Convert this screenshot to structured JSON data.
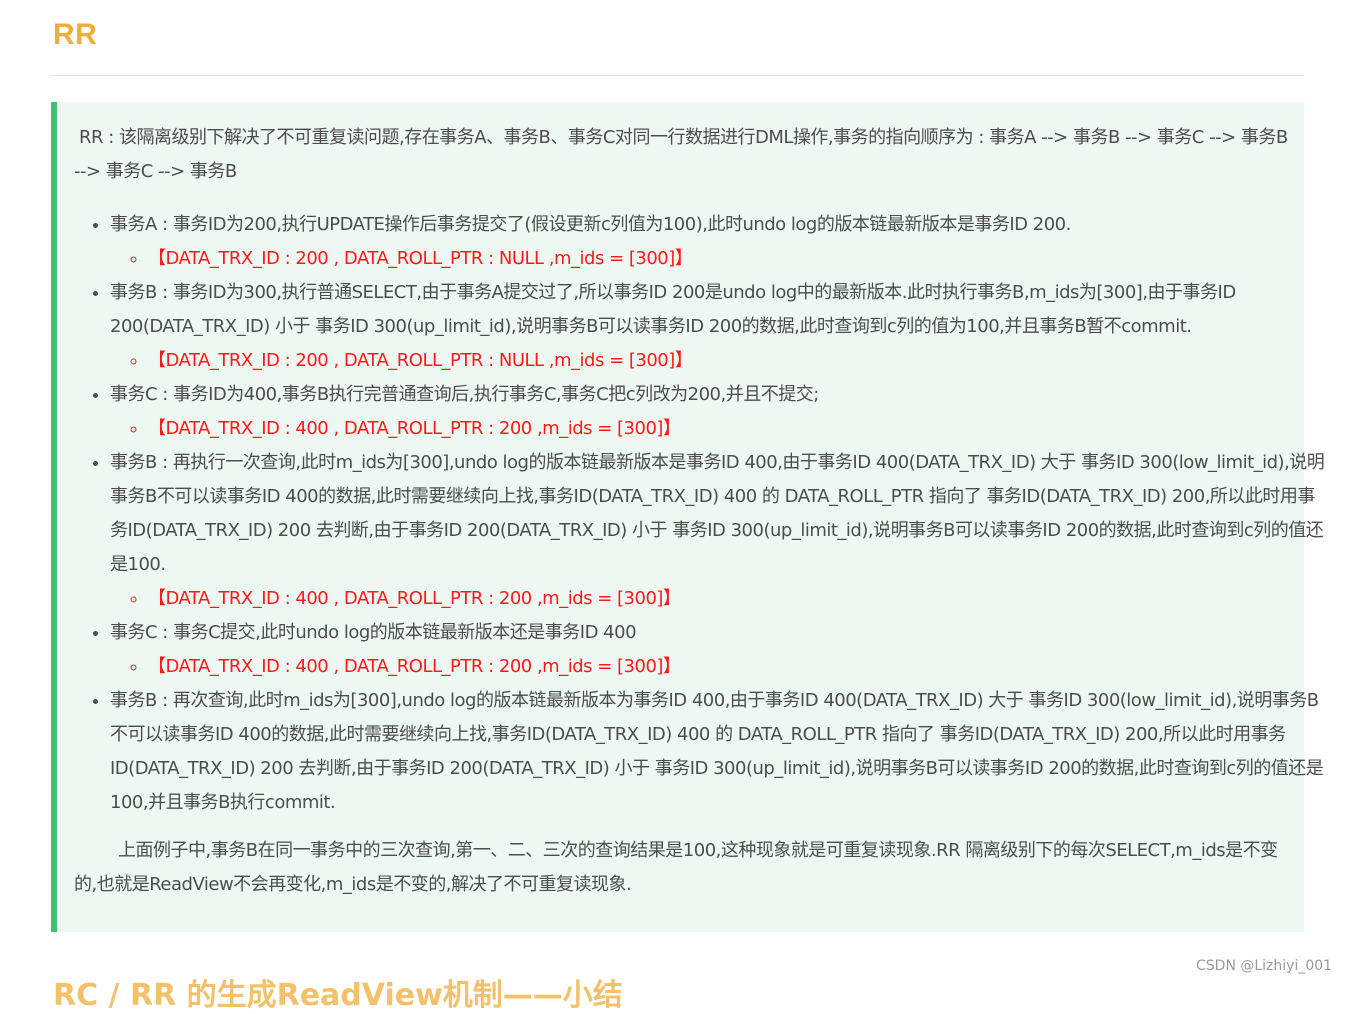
{
  "heading": "RR",
  "intro": "RR : 该隔离级别下解决了不可重复读问题,存在事务A、事务B、事务C对同一行数据进行DML操作,事务的指向顺序为 : 事务A --> 事务B --> 事务C --> 事务B --> 事务C --> 事务B",
  "items": [
    {
      "text": "事务A : 事务ID为200,执行UPDATE操作后事务提交了(假设更新c列值为100),此时undo log的版本链最新版本是事务ID 200.",
      "sub": "【DATA_TRX_ID : 200 , DATA_ROLL_PTR : NULL ,m_ids = [300]】"
    },
    {
      "text": "事务B : 事务ID为300,执行普通SELECT,由于事务A提交过了,所以事务ID 200是undo log中的最新版本.此时执行事务B,m_ids为[300],由于事务ID 200(DATA_TRX_ID) 小于 事务ID 300(up_limit_id),说明事务B可以读事务ID 200的数据,此时查询到c列的值为100,并且事务B暂不commit.",
      "sub": "【DATA_TRX_ID : 200 , DATA_ROLL_PTR : NULL ,m_ids = [300]】"
    },
    {
      "text": "事务C : 事务ID为400,事务B执行完普通查询后,执行事务C,事务C把c列改为200,并且不提交;",
      "sub": "【DATA_TRX_ID : 400 , DATA_ROLL_PTR : 200 ,m_ids = [300]】"
    },
    {
      "text": "事务B : 再执行一次查询,此时m_ids为[300],undo log的版本链最新版本是事务ID 400,由于事务ID 400(DATA_TRX_ID) 大于 事务ID 300(low_limit_id),说明事务B不可以读事务ID 400的数据,此时需要继续向上找,事务ID(DATA_TRX_ID) 400 的 DATA_ROLL_PTR 指向了 事务ID(DATA_TRX_ID) 200,所以此时用事务ID(DATA_TRX_ID) 200 去判断,由于事务ID 200(DATA_TRX_ID) 小于 事务ID 300(up_limit_id),说明事务B可以读事务ID 200的数据,此时查询到c列的值还是100.",
      "sub": "【DATA_TRX_ID : 400 , DATA_ROLL_PTR : 200 ,m_ids = [300]】"
    },
    {
      "text": "事务C : 事务C提交,此时undo log的版本链最新版本还是事务ID 400",
      "sub": "【DATA_TRX_ID : 400 , DATA_ROLL_PTR : 200 ,m_ids = [300]】"
    },
    {
      "text": "事务B : 再次查询,此时m_ids为[300],undo log的版本链最新版本为事务ID 400,由于事务ID 400(DATA_TRX_ID) 大于 事务ID 300(low_limit_id),说明事务B不可以读事务ID 400的数据,此时需要继续向上找,事务ID(DATA_TRX_ID) 400 的 DATA_ROLL_PTR 指向了 事务ID(DATA_TRX_ID) 200,所以此时用事务ID(DATA_TRX_ID) 200 去判断,由于事务ID 200(DATA_TRX_ID) 小于 事务ID 300(up_limit_id),说明事务B可以读事务ID 200的数据,此时查询到c列的值还是100,并且事务B执行commit."
    }
  ],
  "summary": "上面例子中,事务B在同一事务中的三次查询,第一、二、三次的查询结果是100,这种现象就是可重复读现象.RR 隔离级别下的每次SELECT,m_ids是不变的,也就是ReadView不会再变化,m_ids是不变的,解决了不可重复读现象.",
  "next_heading": "RC / RR 的生成ReadView机制——小结",
  "watermark": "CSDN @Lizhiyi_001",
  "colors": {
    "heading": "#f0ad3a",
    "quote_border": "#42c07a",
    "quote_background": "#eef8f2",
    "highlight": "#ff1a1a"
  }
}
